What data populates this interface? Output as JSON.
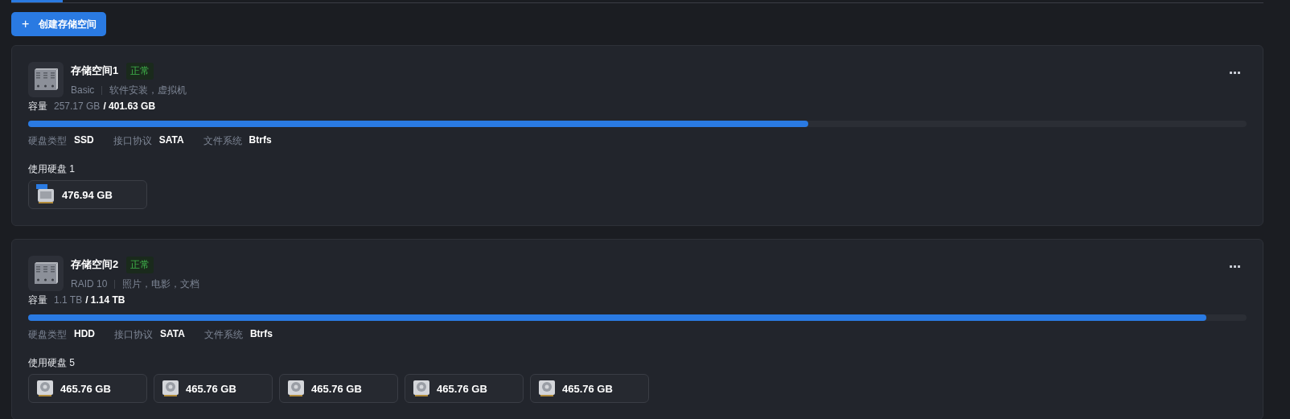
{
  "create_button": {
    "icon": "+",
    "label": "创建存储空间"
  },
  "pools": [
    {
      "name": "存储空间1",
      "status": "正常",
      "raid": "Basic",
      "purpose": "软件安装，虚拟机",
      "capacity_label": "容量",
      "used": "257.17 GB",
      "total": "/ 401.63 GB",
      "level": 0.64,
      "specs": [
        {
          "label": "硬盘类型",
          "value": "SSD"
        },
        {
          "label": "接口协议",
          "value": "SATA"
        },
        {
          "label": "文件系统",
          "value": "Btrfs"
        }
      ],
      "disks_label": "使用硬盘 1",
      "disks": [
        {
          "kind": "ssd",
          "size": "476.94 GB"
        }
      ]
    },
    {
      "name": "存储空间2",
      "status": "正常",
      "raid": "RAID 10",
      "purpose": "照片，电影，文档",
      "capacity_label": "容量",
      "used": "1.1 TB",
      "total": "/ 1.14 TB",
      "level": 0.967,
      "specs": [
        {
          "label": "硬盘类型",
          "value": "HDD"
        },
        {
          "label": "接口协议",
          "value": "SATA"
        },
        {
          "label": "文件系统",
          "value": "Btrfs"
        }
      ],
      "disks_label": "使用硬盘 5",
      "disks": [
        {
          "kind": "hdd",
          "size": "465.76 GB"
        },
        {
          "kind": "hdd",
          "size": "465.76 GB"
        },
        {
          "kind": "hdd",
          "size": "465.76 GB"
        },
        {
          "kind": "hdd",
          "size": "465.76 GB"
        },
        {
          "kind": "hdd",
          "size": "465.76 GB"
        }
      ]
    }
  ]
}
